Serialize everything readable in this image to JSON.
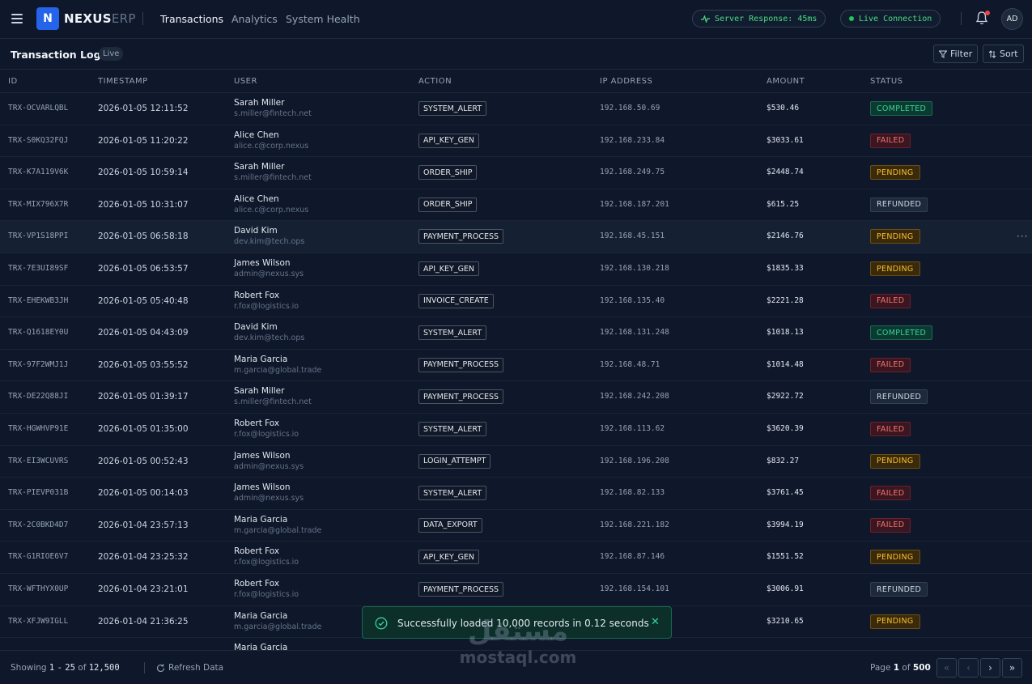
{
  "topbar": {
    "brand_bold": "NEXUS",
    "brand_light": "ERP",
    "logo_letter": "N",
    "nav": [
      {
        "label": "Transactions",
        "active": true
      },
      {
        "label": "Analytics",
        "active": false
      },
      {
        "label": "System Health",
        "active": false
      }
    ],
    "server_response": "Server Response: 45ms",
    "live_connection": "Live Connection",
    "avatar": "AD"
  },
  "subheader": {
    "title": "Transaction Logs",
    "badge": "Live",
    "filter_label": "Filter",
    "sort_label": "Sort"
  },
  "table": {
    "columns": [
      "ID",
      "TIMESTAMP",
      "USER",
      "ACTION",
      "IP ADDRESS",
      "AMOUNT",
      "STATUS"
    ],
    "rows": [
      {
        "id": "TRX-OCVARLQBL",
        "ts": "2026-01-05 12:11:52",
        "name": "Sarah Miller",
        "email": "s.miller@fintech.net",
        "action": "SYSTEM_ALERT",
        "ip": "192.168.50.69",
        "amount": "$530.46",
        "status": "COMPLETED"
      },
      {
        "id": "TRX-S0KQ32FQJ",
        "ts": "2026-01-05 11:20:22",
        "name": "Alice Chen",
        "email": "alice.c@corp.nexus",
        "action": "API_KEY_GEN",
        "ip": "192.168.233.84",
        "amount": "$3033.61",
        "status": "FAILED"
      },
      {
        "id": "TRX-K7A119V6K",
        "ts": "2026-01-05 10:59:14",
        "name": "Sarah Miller",
        "email": "s.miller@fintech.net",
        "action": "ORDER_SHIP",
        "ip": "192.168.249.75",
        "amount": "$2448.74",
        "status": "PENDING"
      },
      {
        "id": "TRX-MIX796X7R",
        "ts": "2026-01-05 10:31:07",
        "name": "Alice Chen",
        "email": "alice.c@corp.nexus",
        "action": "ORDER_SHIP",
        "ip": "192.168.187.201",
        "amount": "$615.25",
        "status": "REFUNDED"
      },
      {
        "id": "TRX-VP1S18PPI",
        "ts": "2026-01-05 06:58:18",
        "name": "David Kim",
        "email": "dev.kim@tech.ops",
        "action": "PAYMENT_PROCESS",
        "ip": "192.168.45.151",
        "amount": "$2146.76",
        "status": "PENDING",
        "highlight": true
      },
      {
        "id": "TRX-7E3UI89SF",
        "ts": "2026-01-05 06:53:57",
        "name": "James Wilson",
        "email": "admin@nexus.sys",
        "action": "API_KEY_GEN",
        "ip": "192.168.130.218",
        "amount": "$1835.33",
        "status": "PENDING"
      },
      {
        "id": "TRX-EHEKWB3JH",
        "ts": "2026-01-05 05:40:48",
        "name": "Robert Fox",
        "email": "r.fox@logistics.io",
        "action": "INVOICE_CREATE",
        "ip": "192.168.135.40",
        "amount": "$2221.28",
        "status": "FAILED"
      },
      {
        "id": "TRX-Q1618EY0U",
        "ts": "2026-01-05 04:43:09",
        "name": "David Kim",
        "email": "dev.kim@tech.ops",
        "action": "SYSTEM_ALERT",
        "ip": "192.168.131.248",
        "amount": "$1018.13",
        "status": "COMPLETED"
      },
      {
        "id": "TRX-97F2WMJ1J",
        "ts": "2026-01-05 03:55:52",
        "name": "Maria Garcia",
        "email": "m.garcia@global.trade",
        "action": "PAYMENT_PROCESS",
        "ip": "192.168.48.71",
        "amount": "$1014.48",
        "status": "FAILED"
      },
      {
        "id": "TRX-DE22Q88JI",
        "ts": "2026-01-05 01:39:17",
        "name": "Sarah Miller",
        "email": "s.miller@fintech.net",
        "action": "PAYMENT_PROCESS",
        "ip": "192.168.242.208",
        "amount": "$2922.72",
        "status": "REFUNDED"
      },
      {
        "id": "TRX-HGWHVP91E",
        "ts": "2026-01-05 01:35:00",
        "name": "Robert Fox",
        "email": "r.fox@logistics.io",
        "action": "SYSTEM_ALERT",
        "ip": "192.168.113.62",
        "amount": "$3620.39",
        "status": "FAILED"
      },
      {
        "id": "TRX-EI3WCUVRS",
        "ts": "2026-01-05 00:52:43",
        "name": "James Wilson",
        "email": "admin@nexus.sys",
        "action": "LOGIN_ATTEMPT",
        "ip": "192.168.196.208",
        "amount": "$832.27",
        "status": "PENDING"
      },
      {
        "id": "TRX-PIEVP031B",
        "ts": "2026-01-05 00:14:03",
        "name": "James Wilson",
        "email": "admin@nexus.sys",
        "action": "SYSTEM_ALERT",
        "ip": "192.168.82.133",
        "amount": "$3761.45",
        "status": "FAILED"
      },
      {
        "id": "TRX-2C0BKD4D7",
        "ts": "2026-01-04 23:57:13",
        "name": "Maria Garcia",
        "email": "m.garcia@global.trade",
        "action": "DATA_EXPORT",
        "ip": "192.168.221.182",
        "amount": "$3994.19",
        "status": "FAILED"
      },
      {
        "id": "TRX-G1RIOE6V7",
        "ts": "2026-01-04 23:25:32",
        "name": "Robert Fox",
        "email": "r.fox@logistics.io",
        "action": "API_KEY_GEN",
        "ip": "192.168.87.146",
        "amount": "$1551.52",
        "status": "PENDING"
      },
      {
        "id": "TRX-WFTHYX0UP",
        "ts": "2026-01-04 23:21:01",
        "name": "Robert Fox",
        "email": "r.fox@logistics.io",
        "action": "PAYMENT_PROCESS",
        "ip": "192.168.154.101",
        "amount": "$3006.91",
        "status": "REFUNDED"
      },
      {
        "id": "TRX-XFJW9IGLL",
        "ts": "2026-01-04 21:36:25",
        "name": "Maria Garcia",
        "email": "m.garcia@global.trade",
        "action": "",
        "ip": "",
        "amount": "$3210.65",
        "status": "PENDING"
      },
      {
        "id": "",
        "ts": "",
        "name": "Maria Garcia",
        "email": "",
        "action": "",
        "ip": "",
        "amount": "",
        "status": ""
      }
    ]
  },
  "footer": {
    "showing_prefix": "Showing",
    "range_start": "1",
    "range_sep": "-",
    "range_end": "25",
    "of_word": "of",
    "total": "12,500",
    "refresh_label": "Refresh Data",
    "page_word": "Page",
    "current_page": "1",
    "of_word2": "of",
    "total_pages": "500"
  },
  "toast": {
    "message": "Successfully loaded 10,000 records in 0.12 seconds"
  },
  "watermark": {
    "arabic": "مستقل",
    "latin": "mostaql.com"
  },
  "colors": {
    "accent": "#2563eb",
    "completed": "#34d399",
    "failed": "#f87171",
    "pending": "#fbbf24",
    "live": "#22c55e"
  }
}
